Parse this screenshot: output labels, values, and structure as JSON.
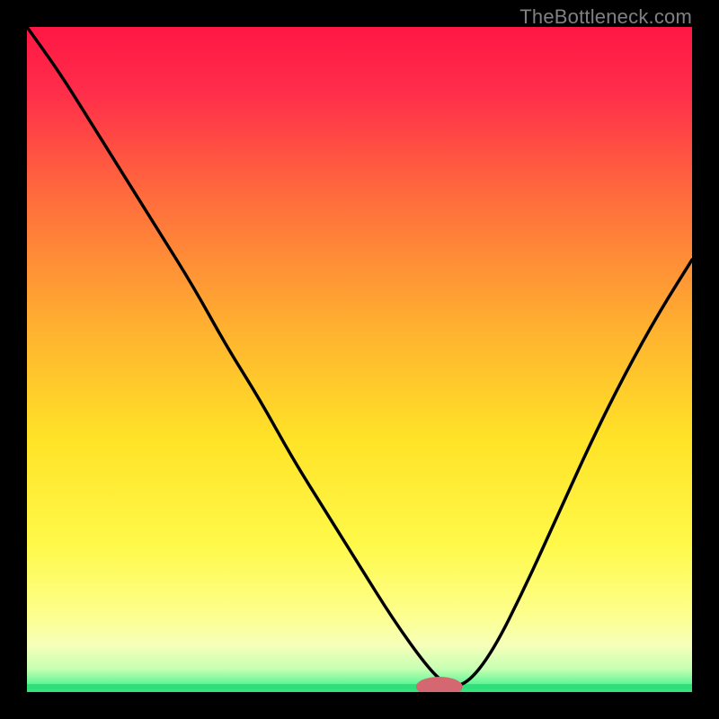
{
  "watermark": "TheBottleneck.com",
  "chart_data": {
    "type": "line",
    "title": "",
    "xlabel": "",
    "ylabel": "",
    "xlim": [
      0,
      100
    ],
    "ylim": [
      0,
      100
    ],
    "series": [
      {
        "name": "curve",
        "x": [
          0,
          5,
          10,
          15,
          20,
          25,
          30,
          35,
          40,
          45,
          50,
          55,
          60,
          63,
          66,
          70,
          75,
          80,
          85,
          90,
          95,
          100
        ],
        "y": [
          100,
          93,
          85,
          77,
          69,
          61,
          52,
          44,
          35,
          27,
          19,
          11,
          4,
          1,
          1,
          6,
          16,
          27,
          38,
          48,
          57,
          65
        ]
      }
    ],
    "marker": {
      "x": 62,
      "y": 0.8,
      "color": "#d4676f",
      "rx": 3.5,
      "ry": 1.5
    },
    "baseline": {
      "y": 0.8,
      "color": "#2fe07a"
    },
    "gradient_stops": [
      {
        "offset": 0.0,
        "color": "#ff1744"
      },
      {
        "offset": 0.1,
        "color": "#ff2e4a"
      },
      {
        "offset": 0.25,
        "color": "#ff6a3d"
      },
      {
        "offset": 0.45,
        "color": "#ffb030"
      },
      {
        "offset": 0.62,
        "color": "#ffe327"
      },
      {
        "offset": 0.78,
        "color": "#fff94a"
      },
      {
        "offset": 0.88,
        "color": "#fdff8a"
      },
      {
        "offset": 0.93,
        "color": "#f6ffb9"
      },
      {
        "offset": 0.965,
        "color": "#c7ffb3"
      },
      {
        "offset": 0.985,
        "color": "#6cf79c"
      },
      {
        "offset": 1.0,
        "color": "#2fe07a"
      }
    ]
  }
}
